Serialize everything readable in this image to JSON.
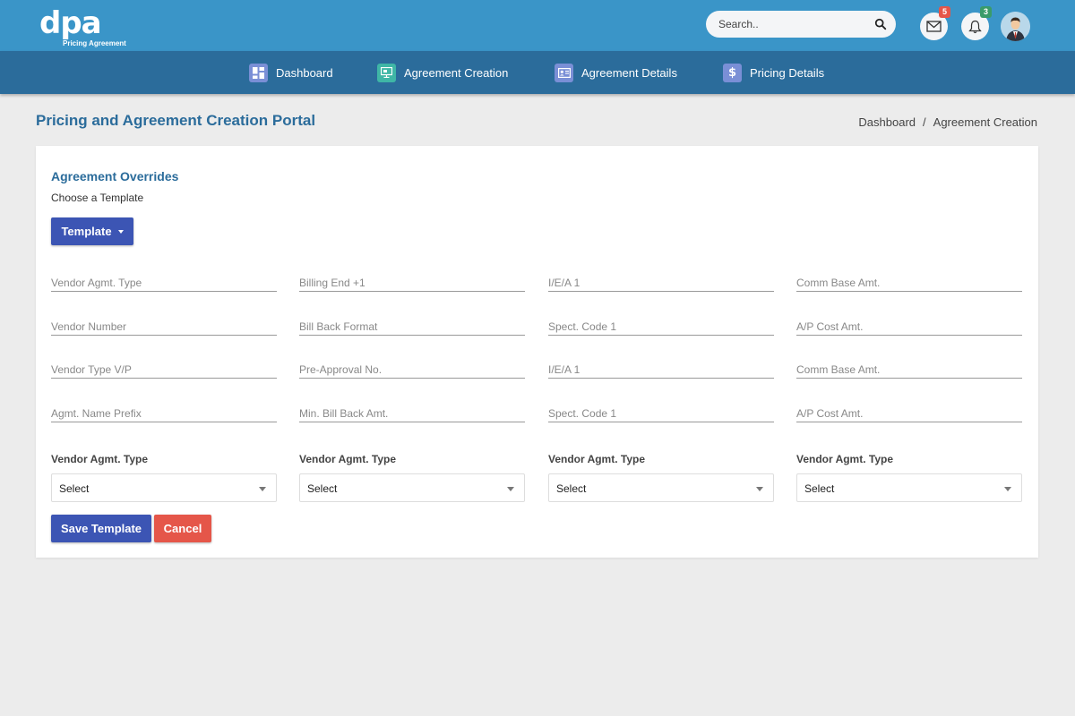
{
  "header": {
    "logo_mark": "dpa",
    "logo_subtitle": "Pricing Agreement",
    "search_placeholder": "Search..",
    "mail_count": "5",
    "notification_count": "3"
  },
  "nav": {
    "items": [
      {
        "label": "Dashboard",
        "icon": "dashboard-icon",
        "color": "#7a8fd6"
      },
      {
        "label": "Agreement Creation",
        "icon": "agreement-creation-icon",
        "color": "#3fb6a6"
      },
      {
        "label": "Agreement Details",
        "icon": "id-card-icon",
        "color": "#7a8fd6"
      },
      {
        "label": "Pricing Details",
        "icon": "dollar-icon",
        "color": "#7a8fd6"
      }
    ]
  },
  "page": {
    "title": "Pricing and Agreement Creation Portal",
    "breadcrumb": [
      "Dashboard",
      "Agreement Creation"
    ]
  },
  "form": {
    "title": "Agreement Overrides",
    "subtitle": "Choose a Template",
    "template_label": "Template",
    "fields": [
      [
        "Vendor Agmt. Type",
        "Billing End +1",
        "I/E/A 1",
        "Comm Base Amt."
      ],
      [
        "Vendor Number",
        "Bill Back Format",
        "Spect. Code 1",
        "A/P Cost Amt."
      ],
      [
        "Vendor Type V/P",
        "Pre-Approval No.",
        "I/E/A 1",
        "Comm Base Amt."
      ],
      [
        "Agmt. Name Prefix",
        "Min. Bill Back Amt.",
        "Spect. Code 1",
        "A/P Cost Amt."
      ]
    ],
    "selects": [
      {
        "label": "Vendor Agmt. Type",
        "value": "Select"
      },
      {
        "label": "Vendor Agmt. Type",
        "value": "Select"
      },
      {
        "label": "Vendor Agmt. Type",
        "value": "Select"
      },
      {
        "label": "Vendor Agmt. Type",
        "value": "Select"
      }
    ],
    "save_label": "Save Template",
    "cancel_label": "Cancel"
  },
  "colors": {
    "header": "#3a95c8",
    "nav": "#2b6c9b",
    "primary": "#3c55b4",
    "danger": "#e55649",
    "mail_badge": "#e55649",
    "notification_badge": "#3a9b6a"
  }
}
